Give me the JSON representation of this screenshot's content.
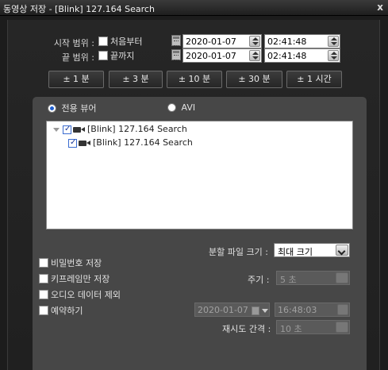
{
  "window": {
    "title": "동영상 저장 - [Blink] 127.164 Search",
    "close_label": "x"
  },
  "range": {
    "start": {
      "label": "시작 범위 :",
      "check_label": "처음부터",
      "checked": false,
      "date": "2020-01-07",
      "time": "02:41:48"
    },
    "end": {
      "label": "끝 범위 :",
      "check_label": "끝까지",
      "checked": false,
      "date": "2020-01-07",
      "time": "02:41:48"
    }
  },
  "quick_buttons": [
    "± 1 분",
    "± 3 분",
    "± 10 분",
    "± 30 분",
    "± 1 시간"
  ],
  "format": {
    "options": [
      {
        "label": "전용 뷰어",
        "selected": true
      },
      {
        "label": "AVI",
        "selected": false
      }
    ]
  },
  "tree": {
    "root": {
      "label": "[Blink] 127.164 Search",
      "checked": true
    },
    "child": {
      "label": "[Blink] 127.164 Search",
      "checked": true
    }
  },
  "options": {
    "split_size_label": "분할 파일 크기 :",
    "split_size_value": "최대 크기",
    "password_label": "비밀번호 저장",
    "keyframe_label": "키프레임만 저장",
    "period_label": "주기 :",
    "period_value": "5 초",
    "audio_label": "오디오 데이터 제외",
    "schedule_label": "예약하기",
    "schedule_date": "2020-01-07",
    "schedule_time": "16:48:03",
    "retry_label": "재시도 간격 :",
    "retry_value": "10 초"
  }
}
